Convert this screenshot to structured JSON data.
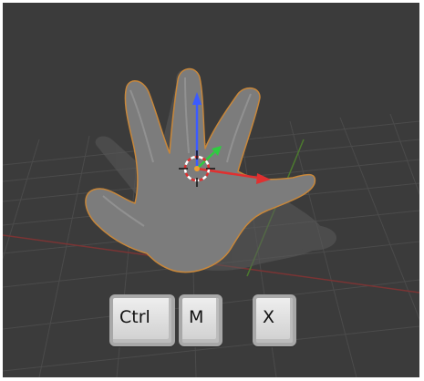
{
  "viewport": {
    "background_color": "#3b3b3b",
    "grid_color": "#4a4a4a",
    "x_axis_color": "#7a3434",
    "y_axis_color": "#4c7a2e",
    "object": "hand-mesh",
    "selection_outline_color": "#c8873a"
  },
  "gizmo": {
    "z_arrow_color": "#3b5bff",
    "x_arrow_color": "#e03030",
    "y_arrow_color": "#2ecc40",
    "cursor_icon": "3d-cursor-icon"
  },
  "shortcut_keys": [
    {
      "label": "Ctrl"
    },
    {
      "label": "M"
    },
    {
      "label": "X"
    }
  ]
}
